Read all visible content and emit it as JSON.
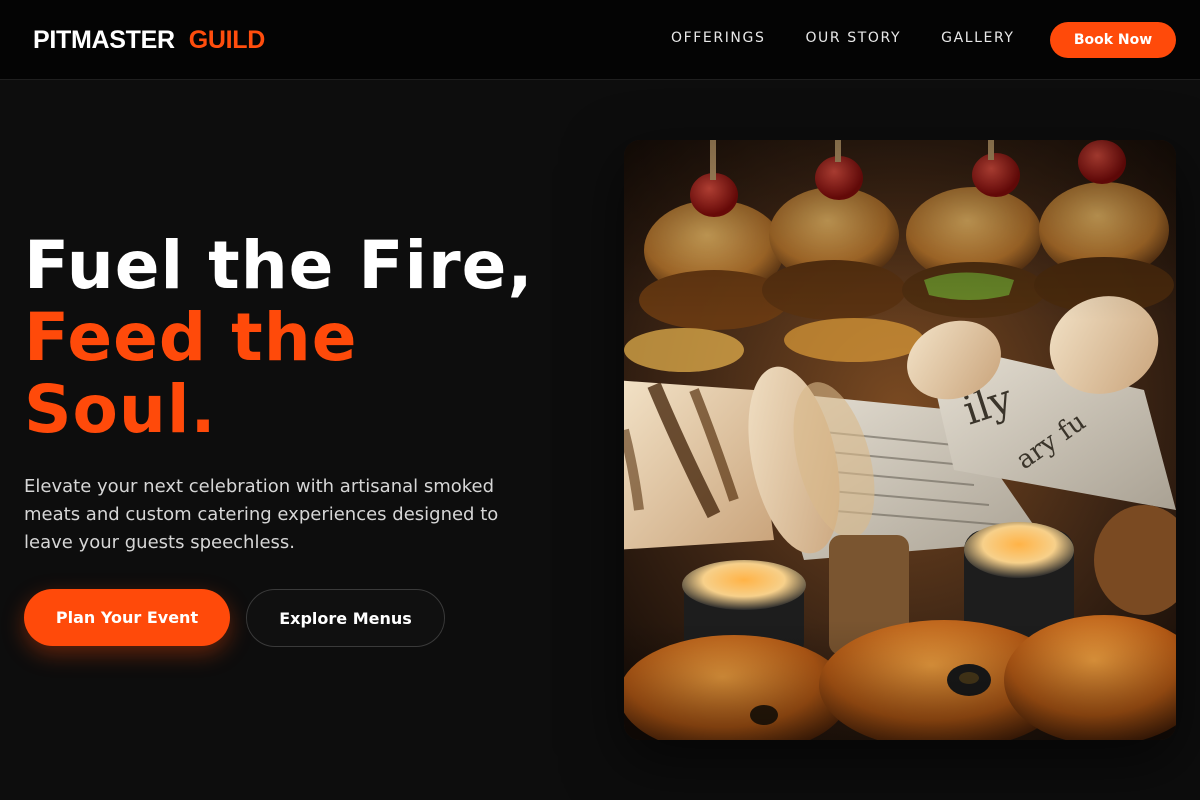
{
  "brand": {
    "word1": "PITMASTER",
    "word2": "GUILD",
    "accent": "#ff4a0a"
  },
  "nav": {
    "links": [
      {
        "label": "OFFERINGS"
      },
      {
        "label": "OUR STORY"
      },
      {
        "label": "GALLERY"
      }
    ],
    "cta_label": "Book Now"
  },
  "hero": {
    "title_line1": "Fuel the Fire,",
    "title_line2": "Feed the Soul.",
    "description": "Elevate your next celebration with artisanal smoked meats and custom catering experiences designed to leave your guests speechless.",
    "primary_cta": "Plan Your Event",
    "secondary_cta": "Explore Menus"
  }
}
